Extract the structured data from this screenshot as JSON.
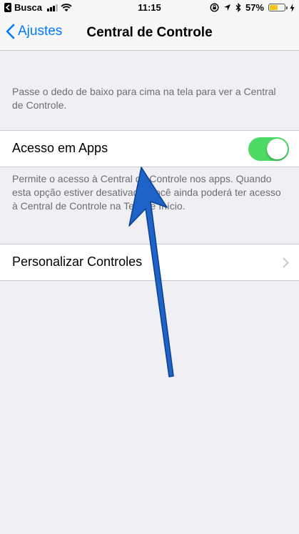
{
  "status_bar": {
    "back_app": "Busca",
    "time": "11:15",
    "battery_percent": "57%",
    "battery_level": 0.57,
    "battery_color": "#f5c41c",
    "icons": [
      "chevron-left-icon",
      "signal-icon",
      "wifi-icon",
      "orientation-lock-icon",
      "location-icon",
      "bluetooth-icon",
      "battery-icon",
      "charging-icon"
    ]
  },
  "nav": {
    "back_label": "Ajustes",
    "title": "Central de Controle",
    "accent": "#007aff"
  },
  "intro_text": "Passe o dedo de baixo para cima na tela para ver a Central de Controle.",
  "access_row": {
    "label": "Acesso em Apps",
    "toggle_on": true,
    "toggle_color": "#4cd964"
  },
  "access_footer": "Permite o acesso à Central de Controle nos apps. Quando esta opção estiver desativada, você ainda poderá ter acesso à Central de Controle na Tela de Início.",
  "customize_row": {
    "label": "Personalizar Controles"
  },
  "annotation": {
    "arrow_color": "#1e63c8",
    "icon": "up-arrow-icon"
  }
}
